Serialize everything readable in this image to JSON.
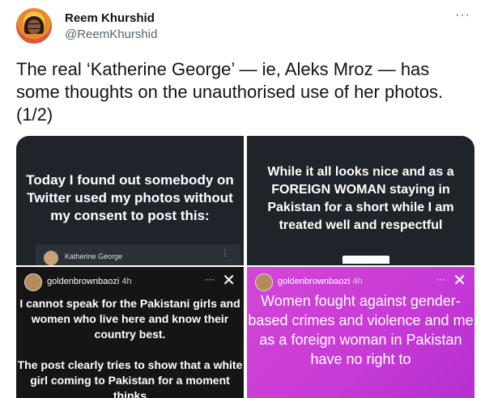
{
  "tweet": {
    "author_name": "Reem Khurshid",
    "author_handle": "@ReemKhurshid",
    "more_label": "···",
    "text": "The real ‘Katherine George’ — ie, Aleks Mroz — has some thoughts on the unauthorised use of her photos. (1/2)"
  },
  "media": {
    "tile1": {
      "text": "Today I found out somebody on Twitter used my photos without my consent to post this:",
      "embedded_name": "Katherine George",
      "embedded_more": "⋮"
    },
    "tile2": {
      "text": "While it all looks nice and as a FOREIGN WOMAN staying in Pakistan for a short while I am treated well and respectful"
    },
    "tile3": {
      "username": "goldenbrownbaozi",
      "time": "4h",
      "dots": "···",
      "close": "✕",
      "text": "I cannot speak for the Pakistani girls and women who live here and know their country best.\n\nThe post clearly tries to show that a white girl coming to Pakistan for a moment thinks"
    },
    "tile4": {
      "username": "goldenbrownbaozi",
      "time": "4h",
      "dots": "···",
      "close": "✕",
      "text": "Women fought against gender-based crimes and violence and me as a foreign woman in Pakistan have no right to"
    }
  }
}
